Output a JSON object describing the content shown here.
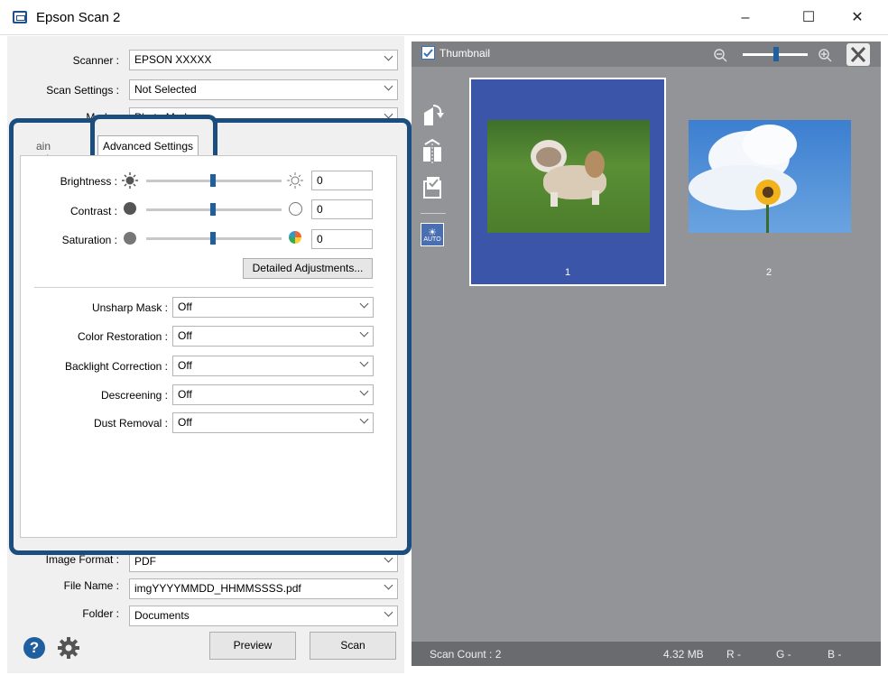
{
  "window": {
    "title": "Epson Scan 2",
    "minimize": "–",
    "maximize": "☐",
    "close": "✕"
  },
  "settings": {
    "scanner_label": "Scanner :",
    "scanner_value": "EPSON XXXXX",
    "scan_settings_label": "Scan Settings :",
    "scan_settings_value": "Not Selected",
    "mode_label": "Mode :",
    "mode_value": "Photo Mode",
    "image_format_label": "Image Format :",
    "image_format_value": "PDF",
    "file_name_label": "File Name :",
    "file_name_value": "imgYYYYMMDD_HHMMSSSS.pdf",
    "folder_label": "Folder :",
    "folder_value": "Documents"
  },
  "tabs": {
    "main_partial": "Main Settings",
    "advanced": "Advanced Settings"
  },
  "adjust": {
    "brightness_label": "Brightness :",
    "brightness_value": "0",
    "contrast_label": "Contrast :",
    "contrast_value": "0",
    "saturation_label": "Saturation :",
    "saturation_value": "0",
    "detailed_button": "Detailed Adjustments..."
  },
  "advanced": {
    "unsharp_label": "Unsharp Mask :",
    "unsharp_value": "Off",
    "color_restore_label": "Color Restoration :",
    "color_restore_value": "Off",
    "backlight_label": "Backlight Correction :",
    "backlight_value": "Off",
    "descreening_label": "Descreening :",
    "descreening_value": "Off",
    "dust_label": "Dust Removal :",
    "dust_value": "Off"
  },
  "buttons": {
    "preview": "Preview",
    "scan": "Scan"
  },
  "preview": {
    "thumbnail_label": "Thumbnail",
    "thumb1_number": "1",
    "thumb2_number": "2"
  },
  "status": {
    "scan_count": "Scan Count : 2",
    "size": "4.32 MB",
    "r": "R -",
    "g": "G -",
    "b": "B -"
  },
  "colors": {
    "accent": "#1b4d7e",
    "selected_thumb": "#3b55a8",
    "preview_bg": "#939497"
  }
}
